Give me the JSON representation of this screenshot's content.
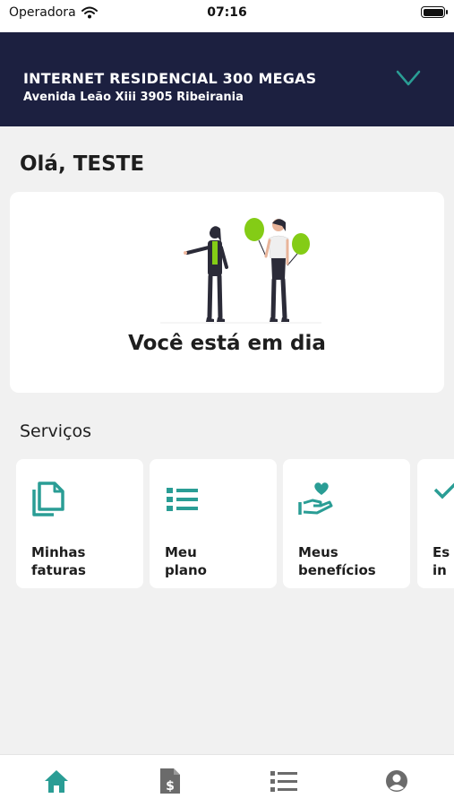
{
  "status_bar": {
    "carrier": "Operadora",
    "time": "07:16"
  },
  "header": {
    "plan_title": "INTERNET RESIDENCIAL 300 MEGAS",
    "address": "Avenida Leão Xiii 3905 Ribeirania"
  },
  "greeting": "Olá, TESTE",
  "status_card": {
    "message": "Você está em dia"
  },
  "services": {
    "title": "Serviços",
    "items": [
      {
        "line1": "Minhas",
        "line2": "faturas",
        "icon": "documents-icon"
      },
      {
        "line1": "Meu",
        "line2": "plano",
        "icon": "list-icon"
      },
      {
        "line1": "Meus",
        "line2": "benefícios",
        "icon": "heart-hand-icon"
      },
      {
        "line1": "Es",
        "line2": "in",
        "icon": "check-icon"
      }
    ]
  },
  "tabbar": {
    "items": [
      {
        "icon": "home-icon",
        "active": true
      },
      {
        "icon": "invoice-icon",
        "active": false
      },
      {
        "icon": "list-icon",
        "active": false
      },
      {
        "icon": "profile-icon",
        "active": false
      }
    ]
  },
  "colors": {
    "header_bg": "#1c2040",
    "accent": "#2a9d95",
    "balloon_green": "#84cc16",
    "tab_inactive": "#6b6b6b"
  }
}
